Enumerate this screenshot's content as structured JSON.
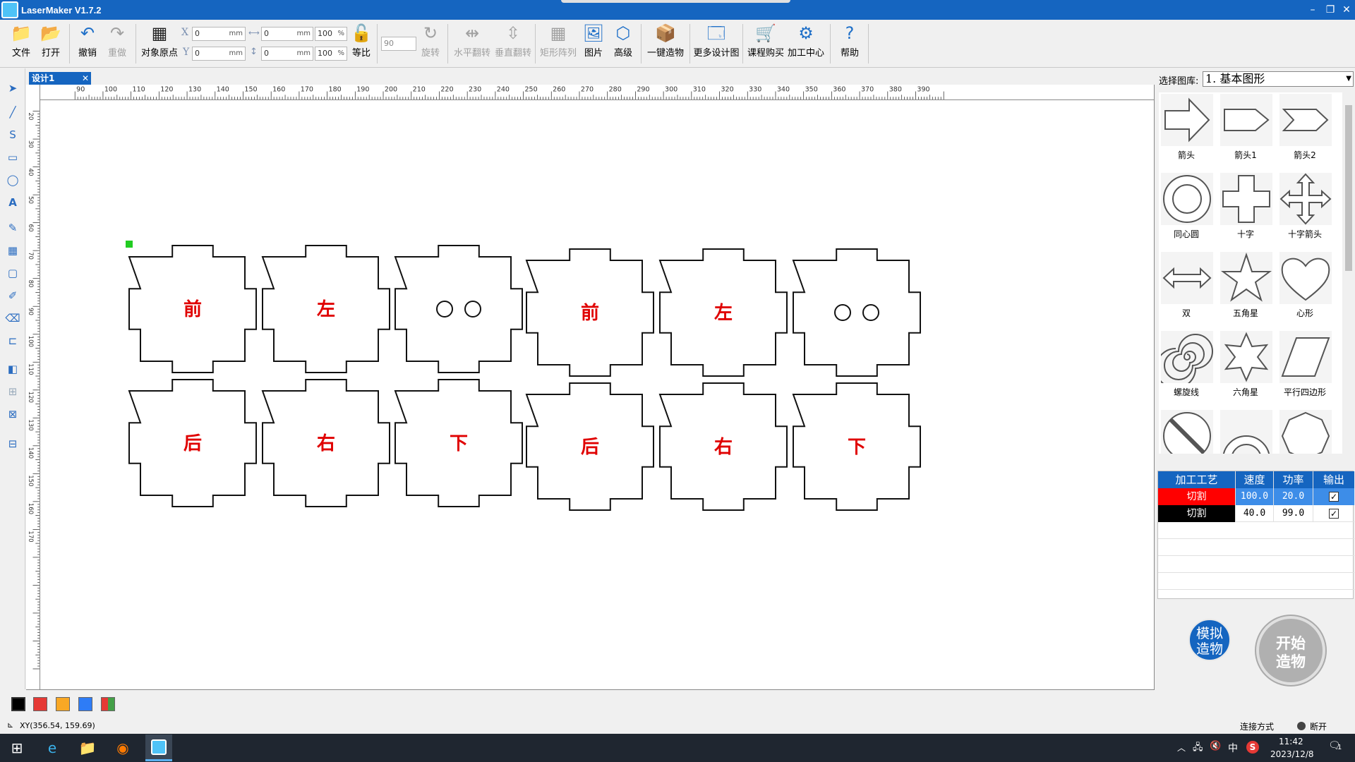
{
  "window": {
    "title": "LaserMaker V1.7.2"
  },
  "toolbar": {
    "file": "文件",
    "open": "打开",
    "undo": "撤销",
    "redo": "重做",
    "object_origin": "对象原点",
    "x_label": "X",
    "y_label": "Y",
    "x_value": "0",
    "y_value": "0",
    "w_value": "0",
    "h_value": "0",
    "unit_mm": "mm",
    "w_pct": "100",
    "h_pct": "100",
    "unit_pct": "%",
    "proportional": "等比",
    "angle_value": "90",
    "rotate": "旋转",
    "flip_h": "水平翻转",
    "flip_v": "垂直翻转",
    "rect_array": "矩形阵列",
    "image": "图片",
    "advanced": "高级",
    "one_click": "一键造物",
    "more_designs": "更多设计图",
    "course_buy": "课程购买",
    "process_center": "加工中心",
    "help": "帮助"
  },
  "design_tab": {
    "label": "设计1",
    "close": "✕"
  },
  "ruler": {
    "h_ticks": [
      "90",
      "100",
      "110",
      "120",
      "130",
      "140",
      "150",
      "160",
      "170",
      "180",
      "190",
      "200",
      "210",
      "220",
      "230",
      "240",
      "250",
      "260",
      "270",
      "280",
      "290",
      "300",
      "310",
      "320",
      "330",
      "340",
      "350",
      "360",
      "370",
      "380",
      "390"
    ],
    "v_ticks": [
      "20",
      "30",
      "40",
      "50",
      "60",
      "70",
      "80",
      "90",
      "100",
      "110",
      "120",
      "130",
      "140",
      "150",
      "160",
      "170"
    ]
  },
  "pieces": {
    "row1": [
      "前",
      "左",
      "",
      "前",
      "左",
      ""
    ],
    "row2": [
      "后",
      "右",
      "下",
      "后",
      "右",
      "下"
    ]
  },
  "library": {
    "label": "选择图库:",
    "selected": "1. 基本图形",
    "shapes": [
      "箭头",
      "箭头1",
      "箭头2",
      "同心圆",
      "十字",
      "十字箭头",
      "双",
      "五角星",
      "心形",
      "螺旋线",
      "六角星",
      "平行四边形"
    ]
  },
  "process_table": {
    "headers": [
      "加工工艺",
      "速度",
      "功率",
      "输出"
    ],
    "rows": [
      {
        "name": "切割",
        "speed": "100.0",
        "power": "20.0",
        "color": "#ff0000"
      },
      {
        "name": "切割",
        "speed": "40.0",
        "power": "99.0",
        "color": "#000000"
      }
    ]
  },
  "buttons": {
    "simulate": "模拟造物",
    "start": "开始造物"
  },
  "palette": [
    "#000000",
    "#e53935",
    "#f9a825",
    "#2e7cf6"
  ],
  "status": {
    "xy": "XY(356.54, 159.69)",
    "connection_label": "连接方式",
    "connection_state": "断开"
  },
  "taskbar": {
    "ime": "中",
    "time": "11:42",
    "date": "2023/12/8",
    "notif": "1"
  }
}
